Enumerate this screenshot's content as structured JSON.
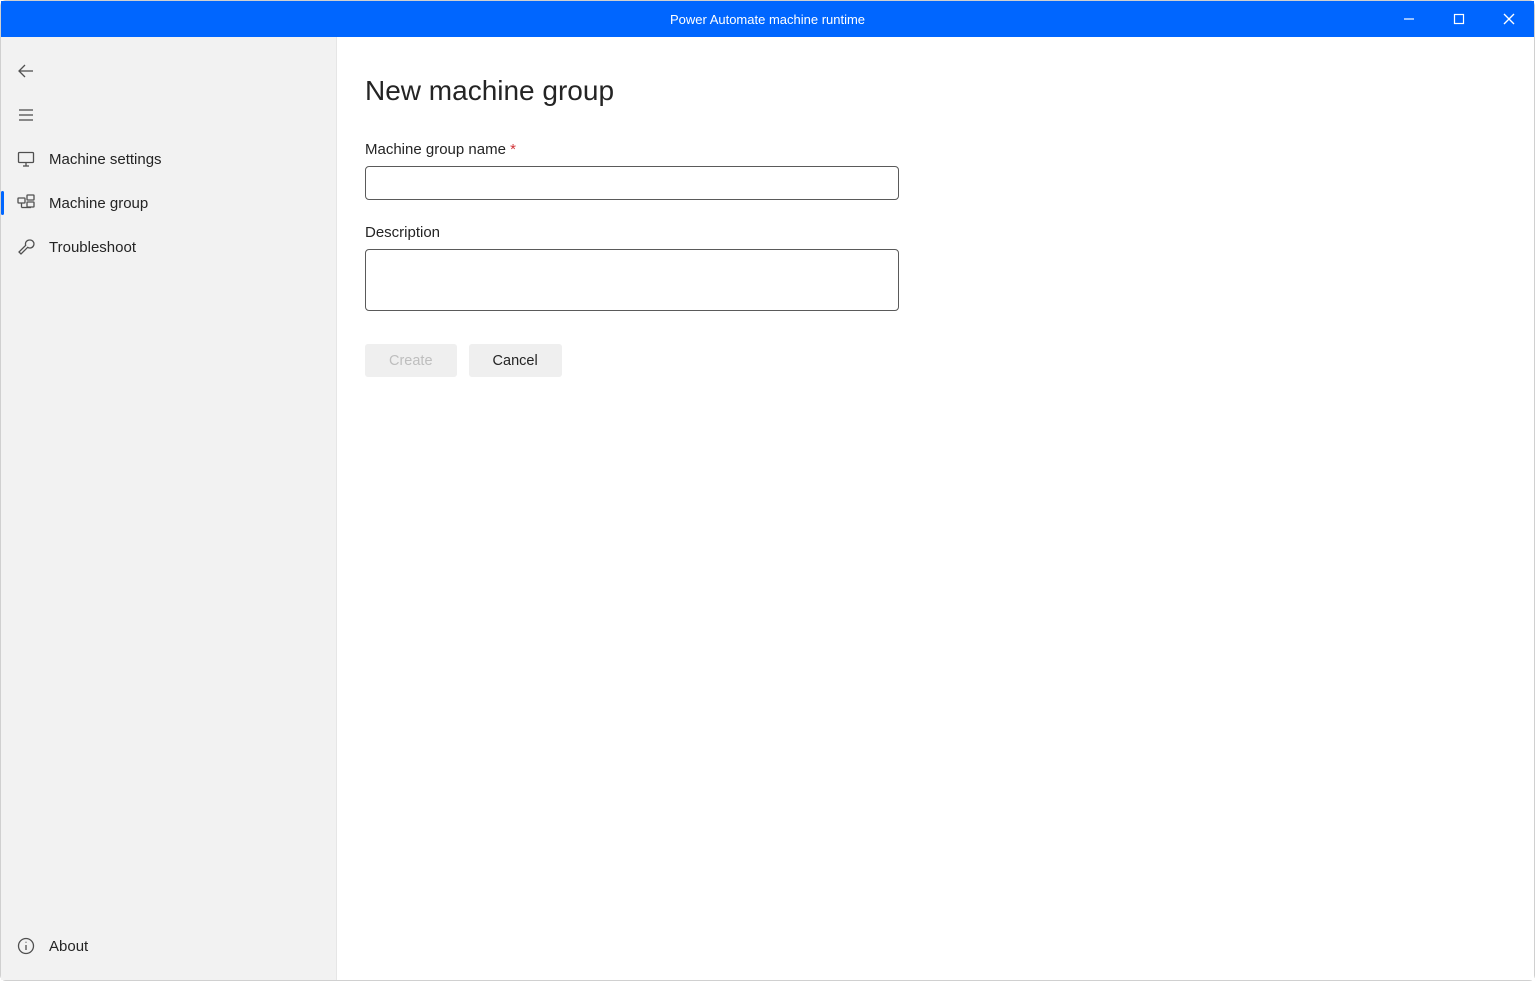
{
  "window": {
    "title": "Power Automate machine runtime"
  },
  "sidebar": {
    "items": [
      {
        "label": "Machine settings"
      },
      {
        "label": "Machine group"
      },
      {
        "label": "Troubleshoot"
      }
    ],
    "footer": {
      "about": "About"
    }
  },
  "main": {
    "title": "New machine group",
    "fields": {
      "name_label": "Machine group name",
      "name_value": "",
      "desc_label": "Description",
      "desc_value": ""
    },
    "buttons": {
      "create": "Create",
      "cancel": "Cancel"
    }
  }
}
